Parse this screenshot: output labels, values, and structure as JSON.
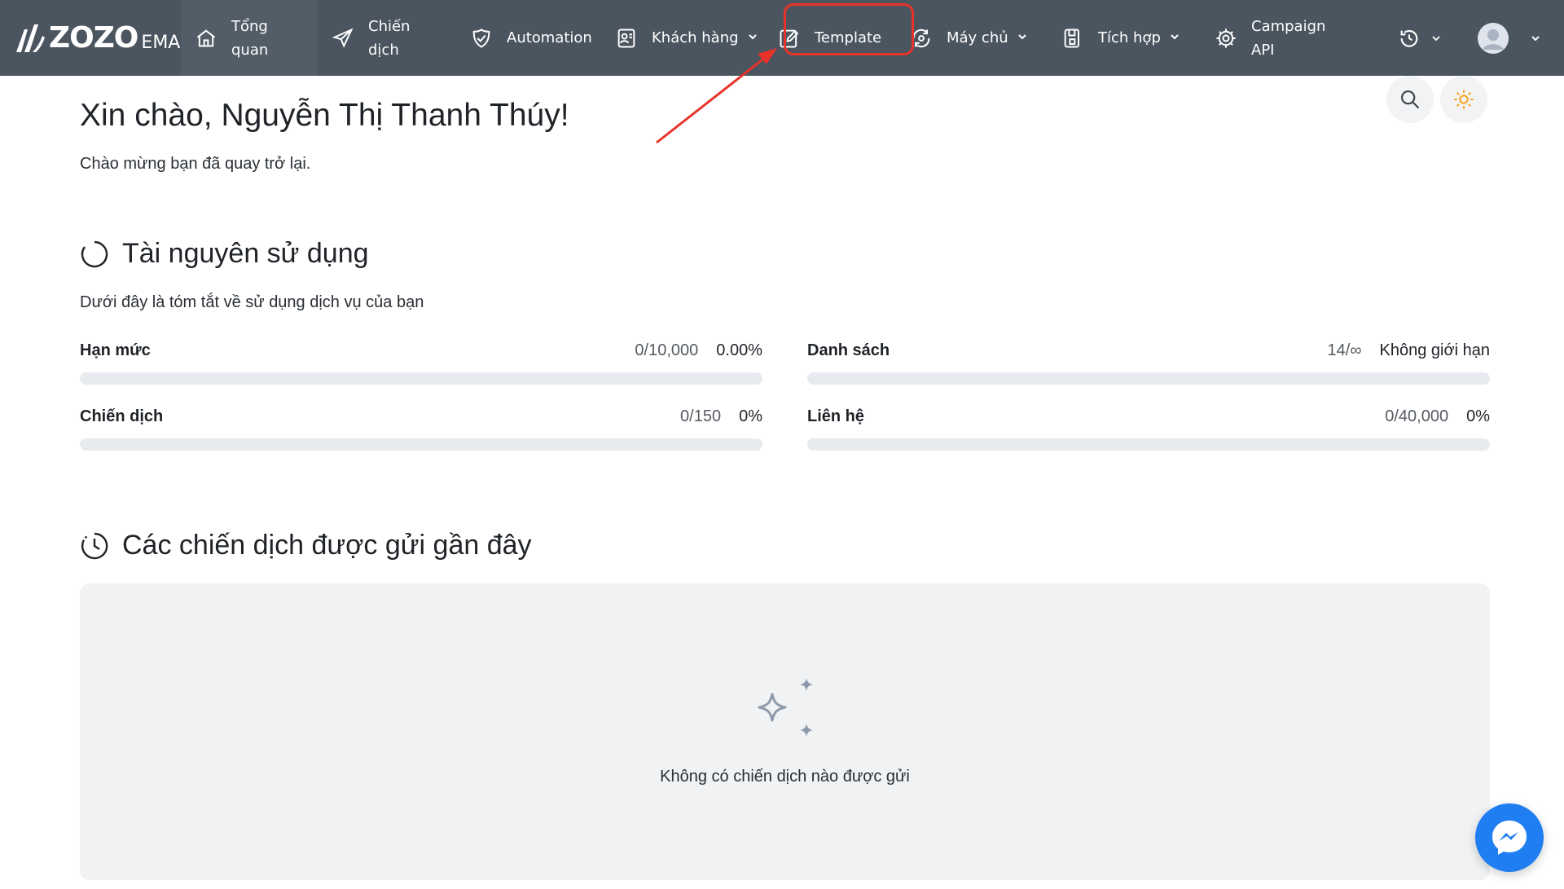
{
  "brand": {
    "name": "ZOZO",
    "suffix": "EMA"
  },
  "nav": {
    "items": [
      {
        "label": "Tổng quan",
        "icon": "home-icon"
      },
      {
        "label": "Chiến dịch",
        "icon": "send-icon"
      },
      {
        "label": "Automation",
        "icon": "shield-check-icon"
      },
      {
        "label": "Khách hàng",
        "icon": "contacts-icon"
      },
      {
        "label": "Template",
        "icon": "edit-icon"
      },
      {
        "label": "Máy chủ",
        "icon": "server-sync-icon"
      },
      {
        "label": "Tích hợp",
        "icon": "integration-icon"
      },
      {
        "label": "Campaign API",
        "icon": "api-gear-icon"
      }
    ]
  },
  "greeting": {
    "title": "Xin chào, Nguyễn Thị Thanh Thúy!",
    "subtitle": "Chào mừng bạn đã quay trở lại."
  },
  "resources": {
    "title": "Tài nguyên sử dụng",
    "subtitle": "Dưới đây là tóm tắt về sử dụng dịch vụ của bạn",
    "meters": [
      {
        "name": "Hạn mức",
        "count": "0/10,000",
        "percent": "0.00%",
        "fill": 0
      },
      {
        "name": "Danh sách",
        "count": "14/∞",
        "percent": "Không giới hạn",
        "fill": 0
      },
      {
        "name": "Chiến dịch",
        "count": "0/150",
        "percent": "0%",
        "fill": 0
      },
      {
        "name": "Liên hệ",
        "count": "0/40,000",
        "percent": "0%",
        "fill": 0
      }
    ]
  },
  "recent": {
    "title": "Các chiến dịch được gửi gần đây",
    "empty_message": "Không có chiến dịch nào được gửi"
  },
  "colors": {
    "nav_bg": "#4a5560",
    "highlight": "#e8332b",
    "messenger": "#1f7ef2",
    "theme_icon": "#f5a623"
  }
}
